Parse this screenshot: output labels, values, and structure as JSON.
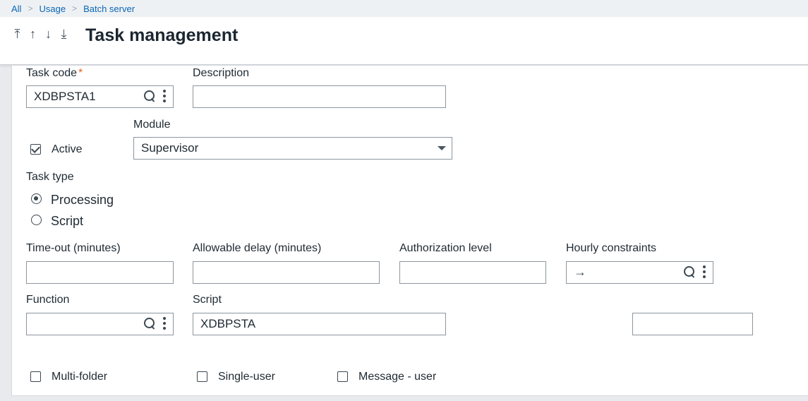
{
  "breadcrumb": [
    "All",
    "Usage",
    "Batch server"
  ],
  "header": {
    "title": "Task management"
  },
  "nav": {
    "first": "⤒",
    "prev": "↑",
    "next": "↓",
    "last": "⤓"
  },
  "form": {
    "task_code": {
      "label": "Task code",
      "required_mark": "*",
      "value": "XDBPSTA1"
    },
    "description": {
      "label": "Description",
      "value": ""
    },
    "active": {
      "label": "Active",
      "checked": true
    },
    "module": {
      "label": "Module",
      "value": "Supervisor"
    },
    "task_type": {
      "label": "Task type",
      "options": [
        "Processing",
        "Script"
      ],
      "selected": "Processing"
    },
    "timeout": {
      "label": "Time-out (minutes)",
      "value": ""
    },
    "allowable_delay": {
      "label": "Allowable delay (minutes)",
      "value": ""
    },
    "authorization_level": {
      "label": "Authorization level",
      "value": ""
    },
    "hourly_constraints": {
      "label": "Hourly constraints",
      "value": "→"
    },
    "function": {
      "label": "Function",
      "value": ""
    },
    "script": {
      "label": "Script",
      "value": "XDBPSTA"
    },
    "extra_field": {
      "value": ""
    },
    "multi_folder": {
      "label": "Multi-folder",
      "checked": false
    },
    "single_user": {
      "label": "Single-user",
      "checked": false
    },
    "message_user": {
      "label": "Message - user",
      "checked": false
    }
  },
  "icons": {
    "lookup": "magnifier-icon",
    "actions": "more-vertical-icon",
    "dropdown": "chevron-down-icon"
  },
  "colors": {
    "link": "#0a66b7",
    "required": "#e9641a",
    "border": "#8d969e"
  }
}
